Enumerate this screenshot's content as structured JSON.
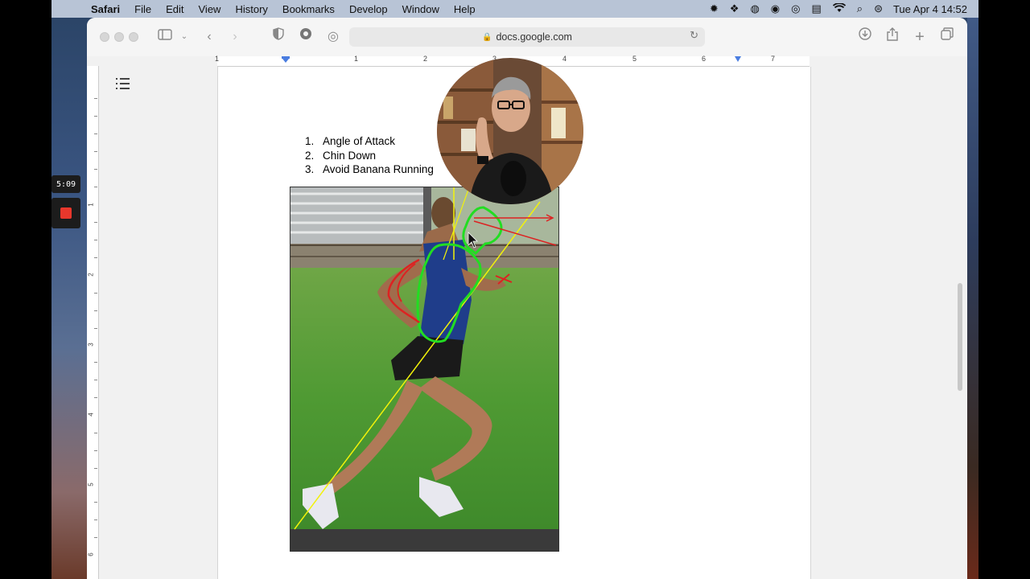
{
  "menubar": {
    "apple": "",
    "items": [
      "Safari",
      "File",
      "Edit",
      "View",
      "History",
      "Bookmarks",
      "Develop",
      "Window",
      "Help"
    ],
    "status_icons": [
      "gear-icon",
      "dropbox-icon",
      "globe-icon",
      "screen-record-icon",
      "vpn-icon",
      "keyboard-icon",
      "wifi-icon",
      "search-icon",
      "control-center-icon"
    ],
    "clock": "Tue Apr 4  14:52"
  },
  "browser": {
    "url": "docs.google.com"
  },
  "ruler": {
    "h_numbers": [
      "1",
      "1",
      "2",
      "3",
      "4",
      "5",
      "6",
      "7"
    ],
    "v_numbers": [
      "1",
      "2",
      "3",
      "4",
      "5",
      "6"
    ]
  },
  "document": {
    "list": [
      {
        "number": "1.",
        "text": "Angle of Attack"
      },
      {
        "number": "2.",
        "text": "Chin Down"
      },
      {
        "number": "3.",
        "text": "Avoid Banana Running"
      }
    ]
  },
  "recording": {
    "timer": "5:09"
  },
  "colors": {
    "menubar": "#b8c4d6",
    "annotation_green": "#22dd22",
    "annotation_yellow": "#f2f20a",
    "annotation_red": "#dd2222",
    "record_red": "#e8372c"
  }
}
